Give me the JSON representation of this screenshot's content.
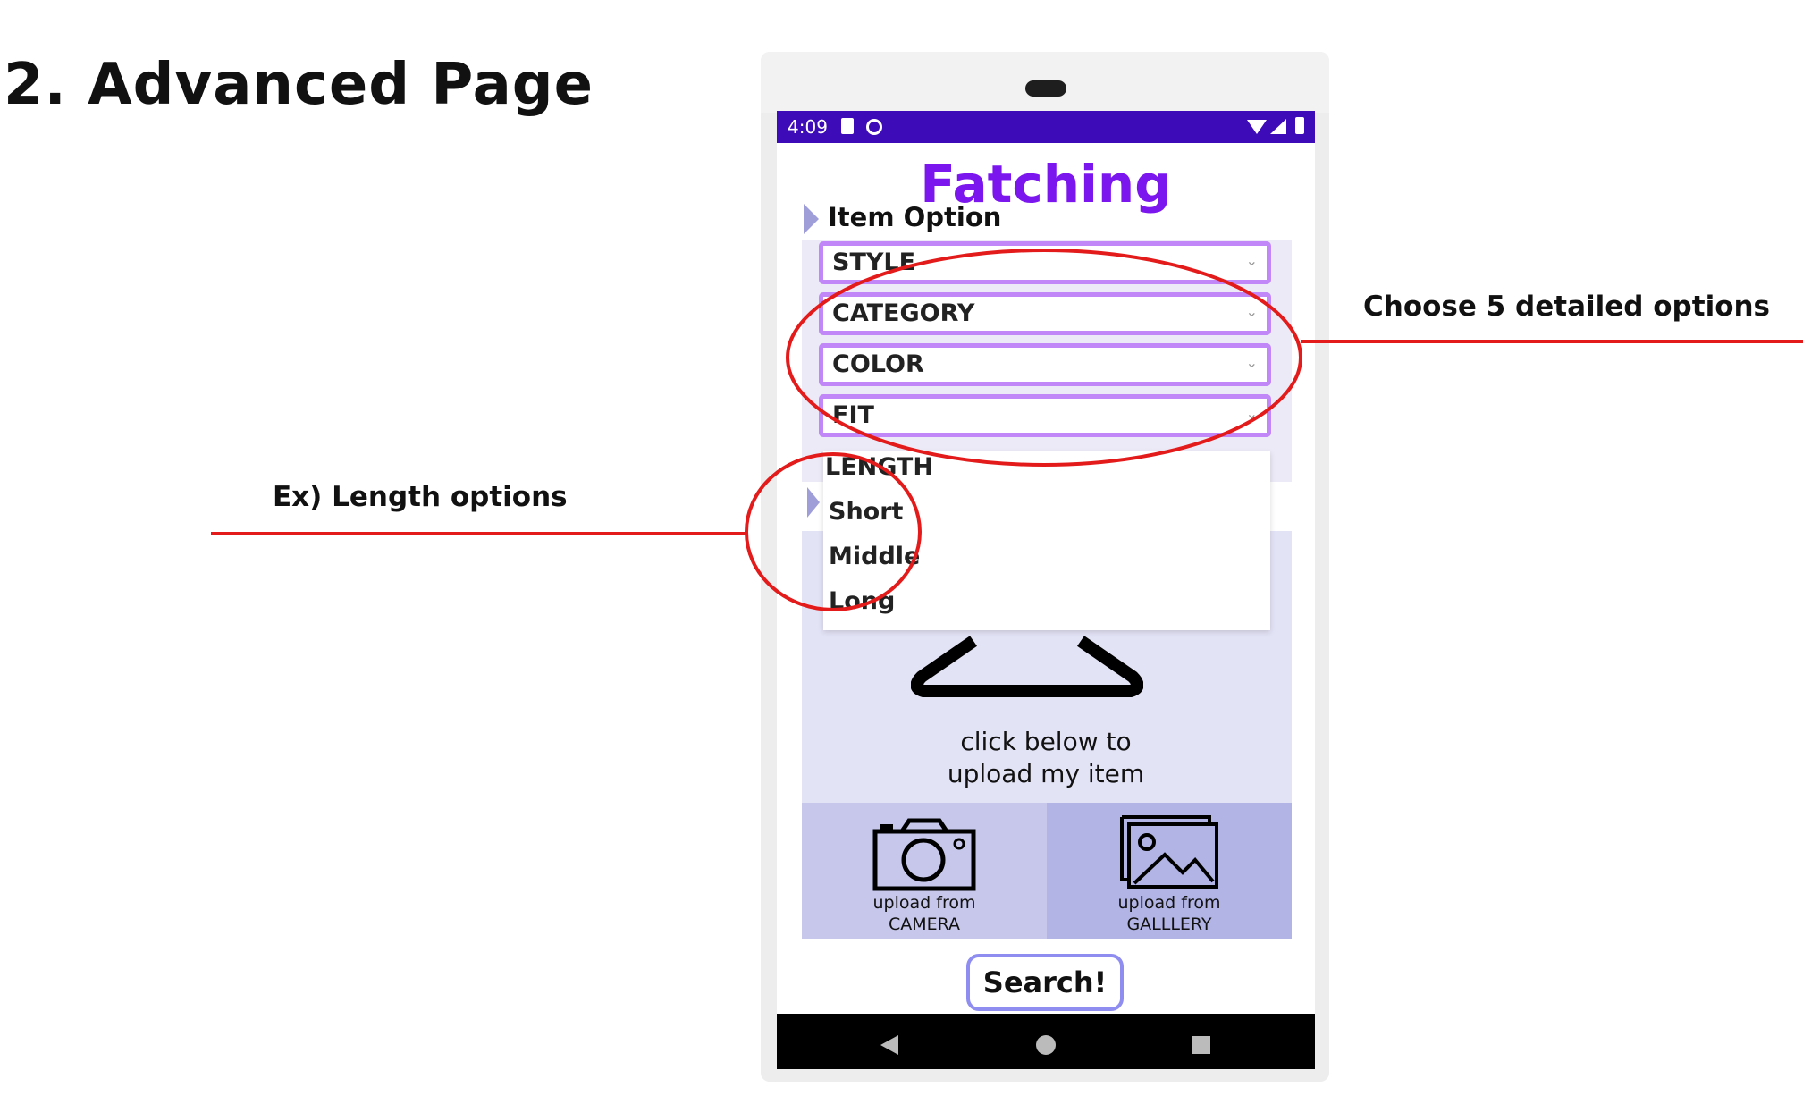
{
  "slide": {
    "title": "2. Advanced Page",
    "annotation_right": "Choose 5 detailed options",
    "annotation_left": "Ex) Length options"
  },
  "status_bar": {
    "time": "4:09",
    "icons": [
      "sd-card-icon",
      "sync-icon",
      "wifi-icon",
      "signal-icon",
      "battery-icon"
    ]
  },
  "app": {
    "title": "Fatching",
    "item_option_label": "Item Option",
    "dropdowns": [
      {
        "label": "STYLE"
      },
      {
        "label": "CATEGORY"
      },
      {
        "label": "COLOR"
      },
      {
        "label": "FIT"
      },
      {
        "label": "LENGTH"
      }
    ],
    "length_menu": [
      "Short",
      "Middle",
      "Long"
    ],
    "upload_prompt_line1": "click below to",
    "upload_prompt_line2": "upload my item",
    "camera_btn": {
      "line1": "upload from",
      "line2": "CAMERA"
    },
    "gallery_btn": {
      "line1": "upload from",
      "line2": "GALLLERY"
    },
    "search_label": "Search!",
    "caret": "⌄"
  },
  "colors": {
    "status_bar": "#3d0bb8",
    "title": "#7b16ef",
    "dropdown_border": "#c186f8",
    "annotation_red": "#e31b1b"
  }
}
